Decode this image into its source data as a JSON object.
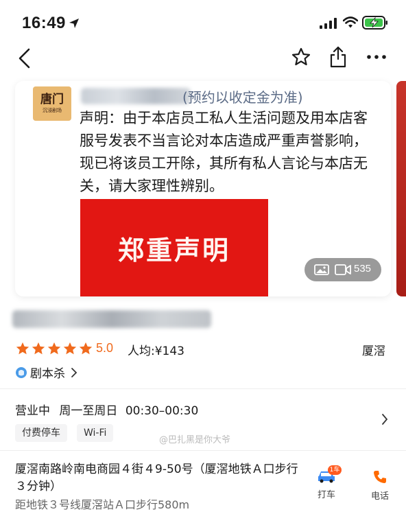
{
  "status_bar": {
    "time": "16:49",
    "icons": [
      "location-arrow-icon",
      "signal-icon",
      "wifi-icon",
      "battery-charging-icon"
    ],
    "accent": "#3cc44a"
  },
  "nav": {
    "icons": [
      "back-icon",
      "star-icon",
      "share-icon",
      "more-icon"
    ]
  },
  "card": {
    "title_visible": "(预约以收定金为准)",
    "logo": {
      "main": "唐门",
      "sub": "沉浸剧场"
    },
    "body": "声明：由于本店员工私人生活问题及用本店客服号发表不当言论对本店造成严重声誉影响，现已将该员工开除，其所有私人言论与本店无关，请大家理性辨别。",
    "banner_text": "郑重声明",
    "banner_color": "#e21713",
    "media_count": "535"
  },
  "shop": {
    "rating_stars": 5,
    "rating": "5.0",
    "avg_price": "人均:¥143",
    "area": "厦滘",
    "category": "剧本杀",
    "star_color": "#f06a1d"
  },
  "hours": {
    "status": "营业中",
    "days": "周一至周日",
    "range": "00:30–00:30",
    "chips": [
      "付费停车",
      "Wi-Fi"
    ],
    "watermark": "@巴扎黑是你大爷"
  },
  "address": {
    "line": "厦滘南路岭南电商园４街４9-50号（厦滘地铁Ａ口步行３分钟）",
    "metro": "距地铁３号线厦滘站Ａ口步行580m",
    "taxi_label": "打车",
    "taxi_badge": "1车",
    "phone_label": "电话"
  }
}
